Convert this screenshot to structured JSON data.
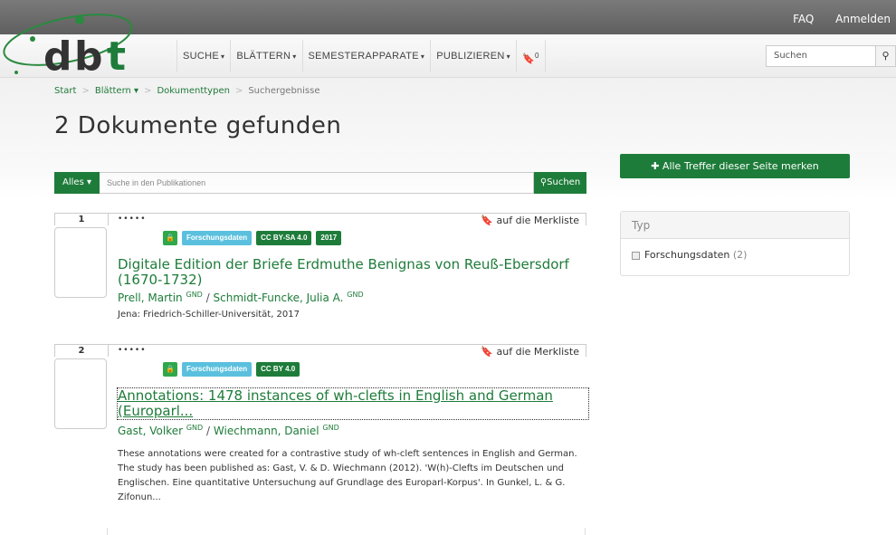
{
  "topbar": {
    "faq": "FAQ",
    "login": "Anmelden"
  },
  "nav": {
    "items": [
      "SUCHE",
      "BLÄTTERN",
      "SEMESTERAPPARATE",
      "PUBLIZIEREN"
    ],
    "bookmark_count": "0",
    "search_placeholder": "Suchen"
  },
  "breadcrumb": {
    "start": "Start",
    "browse": "Blättern",
    "doctypes": "Dokumenttypen",
    "current": "Suchergebnisse"
  },
  "title": "2 Dokumente gefunden",
  "search": {
    "scope": "Alles",
    "placeholder": "Suche in den Publikationen",
    "button": "Suchen"
  },
  "merken_all": "Alle Treffer dieser Seite merken",
  "facet": {
    "head": "Typ",
    "item": "Forschungsdaten",
    "count": "(2)"
  },
  "results": [
    {
      "num": "1",
      "dots": "•••••",
      "merk": "auf die Merkliste",
      "badges": [
        "Forschungsdaten",
        "CC BY-SA 4.0",
        "2017"
      ],
      "title": "Digitale Edition der Briefe Erdmuthe Benignas von Reuß-Ebersdorf (1670-1732)",
      "author1": "Prell, Martin",
      "author2": "Schmidt-Funcke, Julia A.",
      "gnd": "GND",
      "pub": "Jena: Friedrich-Schiller-Universität, 2017"
    },
    {
      "num": "2",
      "dots": "•••••",
      "merk": "auf die Merkliste",
      "badges": [
        "Forschungsdaten",
        "CC BY 4.0"
      ],
      "title": "Annotations: 1478 instances of wh-clefts in English and German (Europarl...",
      "author1": "Gast, Volker",
      "author2": "Wiechmann, Daniel",
      "gnd": "GND",
      "abstract": "These annotations were created for a contrastive study of wh-cleft sentences in English and German. The study has been published as: Gast, V. & D. Wiechmann (2012). 'W(h)-Clefts im Deutschen und Englischen. Eine quantitative Untersuchung auf Grundlage des Europarl-Korpus'. In Gunkel, L. & G. Zifonun..."
    }
  ]
}
